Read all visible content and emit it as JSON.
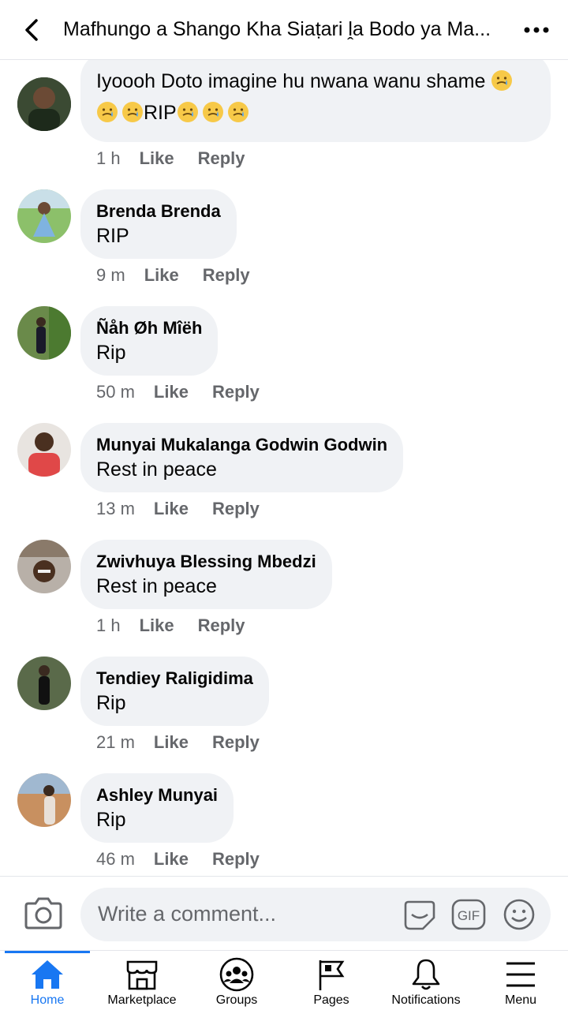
{
  "header": {
    "title": "Mafhungo a Shango Kha Siaṭari ḽa Bodo ya Ma..."
  },
  "comments": [
    {
      "text_line1": "Iyoooh Doto imagine hu nwana wanu shame",
      "text_line2": "RIP",
      "time": "1 h",
      "like": "Like",
      "reply": "Reply",
      "emoji": "crying-face"
    },
    {
      "author": "Brenda Brenda",
      "text": "RIP",
      "time": "9 m",
      "like": "Like",
      "reply": "Reply"
    },
    {
      "author": "Ñåh Øh Mîëh",
      "text": "Rip",
      "time": "50 m",
      "like": "Like",
      "reply": "Reply"
    },
    {
      "author": "Munyai Mukalanga Godwin Godwin",
      "text": "Rest in peace",
      "time": "13 m",
      "like": "Like",
      "reply": "Reply"
    },
    {
      "author": "Zwivhuya Blessing Mbedzi",
      "text": "Rest in peace",
      "time": "1 h",
      "like": "Like",
      "reply": "Reply"
    },
    {
      "author": "Tendiey Raligidima",
      "text": "Rip",
      "time": "21 m",
      "like": "Like",
      "reply": "Reply"
    },
    {
      "author": "Ashley Munyai",
      "text": "Rip",
      "time": "46 m",
      "like": "Like",
      "reply": "Reply"
    }
  ],
  "composer": {
    "placeholder": "Write a comment...",
    "gif_label": "GIF"
  },
  "nav": {
    "items": [
      {
        "label": "Home",
        "icon": "home-icon",
        "active": true
      },
      {
        "label": "Marketplace",
        "icon": "marketplace-icon"
      },
      {
        "label": "Groups",
        "icon": "groups-icon"
      },
      {
        "label": "Pages",
        "icon": "pages-flag-icon"
      },
      {
        "label": "Notifications",
        "icon": "bell-icon"
      },
      {
        "label": "Menu",
        "icon": "hamburger-icon"
      }
    ]
  },
  "colors": {
    "accent": "#1877f2",
    "bubble": "#f0f2f5",
    "meta": "#65676b"
  }
}
